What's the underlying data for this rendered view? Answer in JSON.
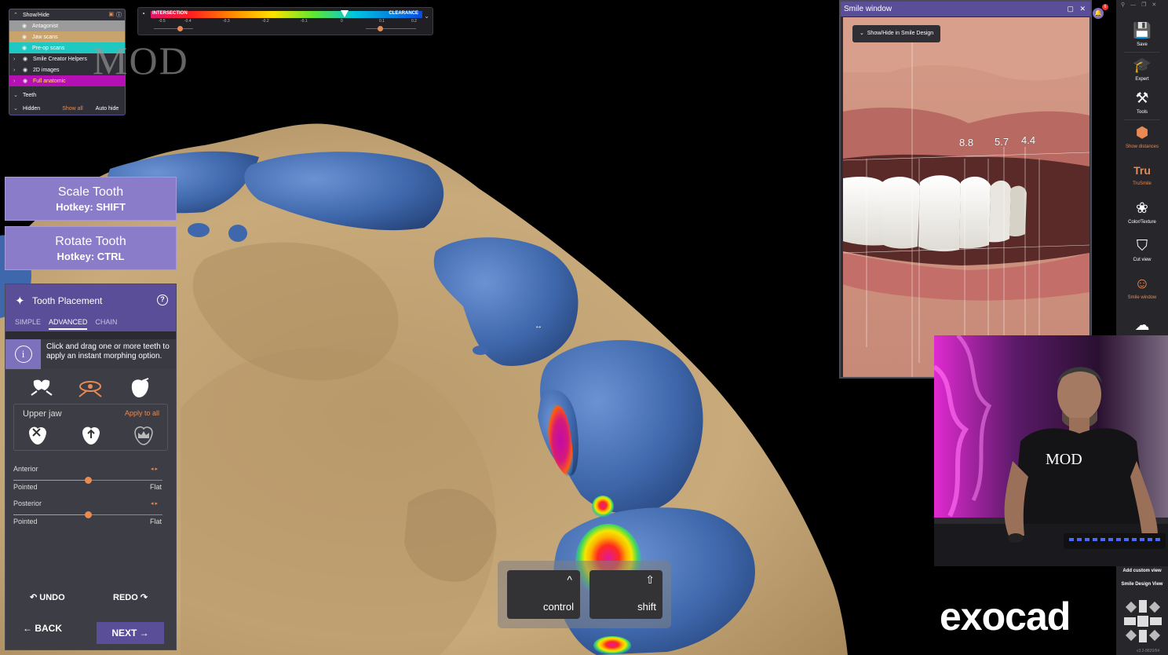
{
  "show_hide": {
    "title": "Show/Hide",
    "items": [
      {
        "label": "Antagonist"
      },
      {
        "label": "Jaw scans"
      },
      {
        "label": "Pre-op scans"
      },
      {
        "label": "Smile Creator Helpers"
      },
      {
        "label": "2D images"
      },
      {
        "label": "Full anatomic"
      }
    ],
    "teeth": "Teeth",
    "hidden": "Hidden",
    "show_all": "Show all",
    "auto_hide": "Auto hide"
  },
  "watermark": "MOD",
  "intersection_bar": {
    "left_label": "INTERSECTION",
    "right_label": "CLEARANCE",
    "ticks": [
      "-0.5",
      "-0.4",
      "-0.3",
      "-0.2",
      "-0.1",
      "0",
      "0.1",
      "0.2"
    ]
  },
  "scale_tooth": {
    "title": "Scale Tooth",
    "hotkey": "Hotkey: SHIFT"
  },
  "rotate_tooth": {
    "title": "Rotate Tooth",
    "hotkey": "Hotkey: CTRL"
  },
  "tooth_placement": {
    "title": "Tooth Placement",
    "tabs": [
      {
        "label": "SIMPLE"
      },
      {
        "label": "ADVANCED"
      },
      {
        "label": "CHAIN"
      }
    ],
    "active_tab": "ADVANCED",
    "info_line1": "Click and drag one or more teeth to",
    "info_line2": "apply an instant morphing option.",
    "upper_jaw": "Upper jaw",
    "apply_to_all": "Apply to all",
    "anterior": {
      "label": "Anterior",
      "left": "Pointed",
      "right": "Flat",
      "value": 0.5
    },
    "posterior": {
      "label": "Posterior",
      "left": "Pointed",
      "right": "Flat",
      "value": 0.5
    },
    "undo": "UNDO",
    "redo": "REDO",
    "back": "BACK",
    "next": "NEXT"
  },
  "keys": {
    "control": {
      "symbol": "^",
      "name": "control"
    },
    "shift": {
      "symbol": "⇧",
      "name": "shift"
    }
  },
  "smile_window": {
    "title": "Smile window",
    "toggle_button": "Show/Hide in Smile Design",
    "measurements": [
      "8.8",
      "5.7",
      "4.4"
    ]
  },
  "notification_count": "6",
  "right_toolbar": {
    "items": [
      {
        "label": "Save",
        "icon": "save-icon",
        "active": false
      },
      {
        "label": "Expert",
        "icon": "graduation-cap-icon",
        "active": false
      },
      {
        "label": "Tools",
        "icon": "tools-icon",
        "active": false
      },
      {
        "label": "Show distances",
        "icon": "distances-icon",
        "active": true
      },
      {
        "label": "TruSmile",
        "icon": "trusmile-icon",
        "active": true
      },
      {
        "label": "Color/Texture",
        "icon": "palette-icon",
        "active": false
      },
      {
        "label": "Cut view",
        "icon": "cut-view-icon",
        "active": false
      },
      {
        "label": "Smile window",
        "icon": "face-icon",
        "active": true
      }
    ],
    "add_custom_view": "Add custom view",
    "smile_design_view": "Smile Design View",
    "version": "v3.2-8820/64"
  },
  "webcam": {
    "shirt_logo": "MOD"
  },
  "brand": "exocad",
  "colors": {
    "accent_purple": "#5b4e98",
    "button_purple": "#8a7cc8",
    "orange": "#e98a53",
    "gum": "#c8a87a",
    "tooth_blue": "#3c64a8"
  }
}
